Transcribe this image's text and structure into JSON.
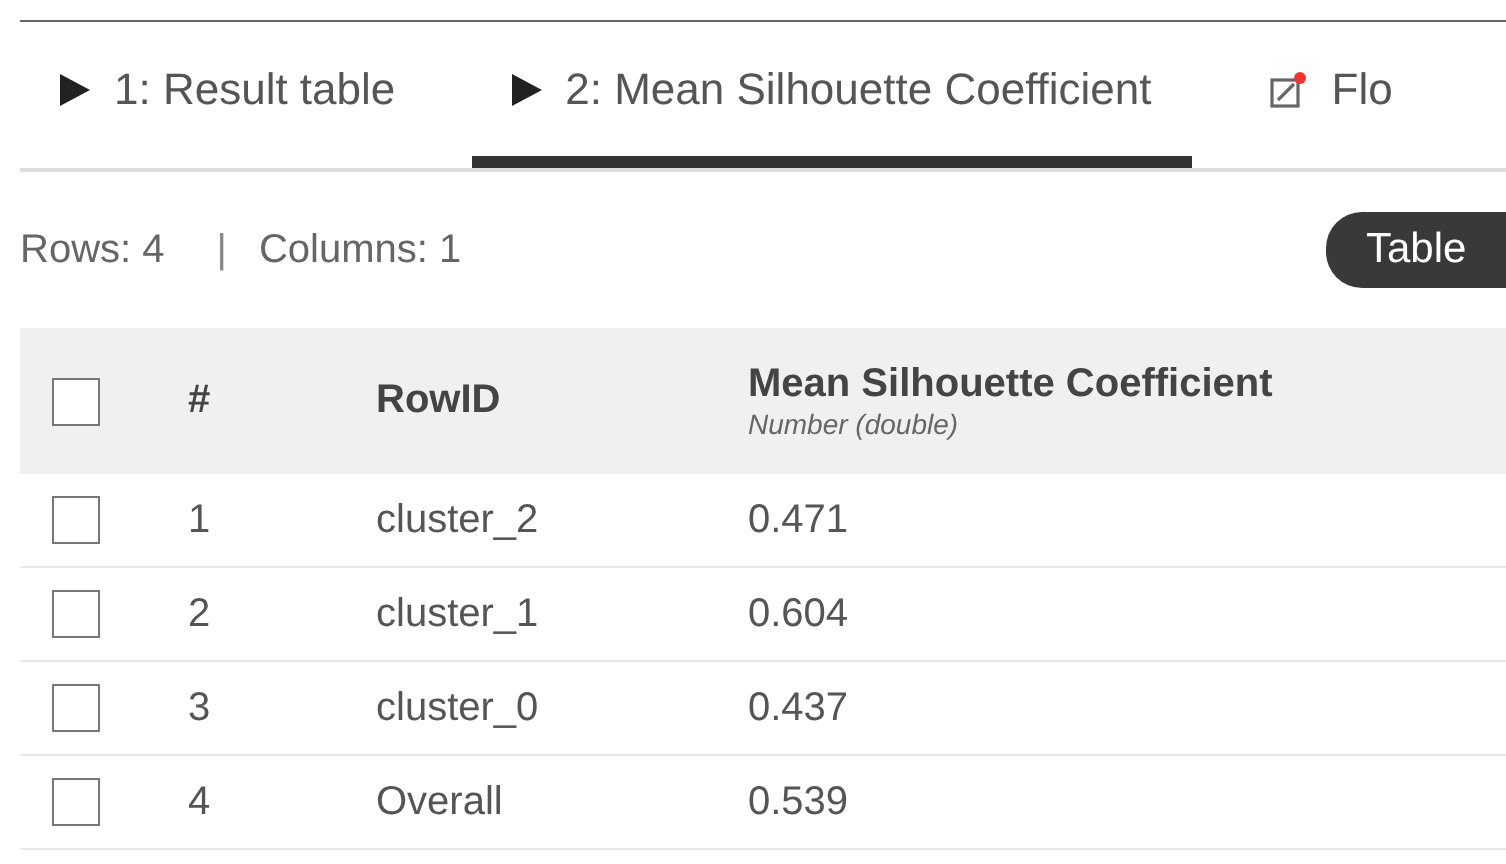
{
  "tabs": [
    {
      "kind": "port",
      "label": "1: Result table",
      "selected": false
    },
    {
      "kind": "port",
      "label": "2: Mean Silhouette Coefficient",
      "selected": true
    },
    {
      "kind": "flow",
      "label": "Flo",
      "selected": false
    }
  ],
  "summary": {
    "rows": "Rows: 4",
    "separator": "|",
    "columns": "Columns: 1"
  },
  "view_toggle": "Table",
  "table": {
    "select_all": {
      "checked": false
    },
    "columns": [
      {
        "label": "#"
      },
      {
        "label": "RowID"
      },
      {
        "label": "Mean Silhouette Coefficient",
        "type": "Number (double)"
      }
    ],
    "rows": [
      {
        "checked": false,
        "cells": [
          "1",
          "cluster_2",
          "0.471"
        ]
      },
      {
        "checked": false,
        "cells": [
          "2",
          "cluster_1",
          "0.604"
        ]
      },
      {
        "checked": false,
        "cells": [
          "3",
          "cluster_0",
          "0.437"
        ]
      },
      {
        "checked": false,
        "cells": [
          "4",
          "Overall",
          "0.539"
        ]
      }
    ]
  }
}
